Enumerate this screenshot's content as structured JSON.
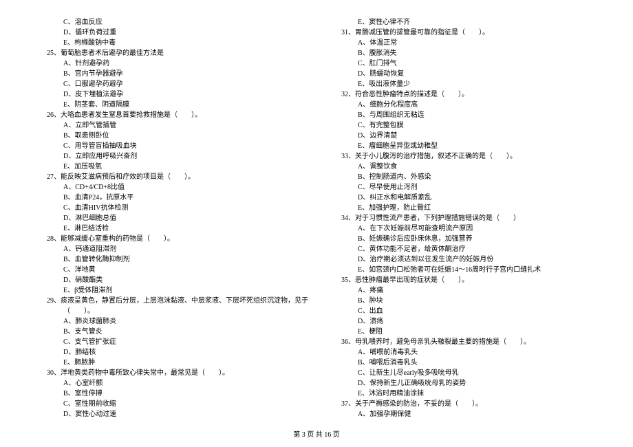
{
  "footer": "第 3 页 共 16 页",
  "left_column": [
    {
      "type": "option",
      "text": "C、溶血反应"
    },
    {
      "type": "option",
      "text": "D、循环负荷过重"
    },
    {
      "type": "option",
      "text": "E、枸橼酸钠中毒"
    },
    {
      "type": "question",
      "text": "25、葡萄胎患者术后避孕的最佳方法是"
    },
    {
      "type": "option",
      "text": "A、针剂避孕药"
    },
    {
      "type": "option",
      "text": "B、宫内节孕器避孕"
    },
    {
      "type": "option",
      "text": "C、口服避孕药避孕"
    },
    {
      "type": "option",
      "text": "D、皮下埋植法避孕"
    },
    {
      "type": "option",
      "text": "E、阴茎套、阴道隔膜"
    },
    {
      "type": "question",
      "text": "26、大咯血患者发生窒息首要抢救措施是（　　）。"
    },
    {
      "type": "option",
      "text": "A、立即气管插管"
    },
    {
      "type": "option",
      "text": "B、取患侧卧位"
    },
    {
      "type": "option",
      "text": "C、用导管盲插抽吸血块"
    },
    {
      "type": "option",
      "text": "D、立即应用呼吸兴奋剂"
    },
    {
      "type": "option",
      "text": "E、加压吸氧"
    },
    {
      "type": "question",
      "text": "27、能反映艾滋病预后和疗效的项目是（　　）。"
    },
    {
      "type": "option",
      "text": "A、CD+4/CD+8比值"
    },
    {
      "type": "option",
      "text": "B、血清P24，抗原水平"
    },
    {
      "type": "option",
      "text": "C、血清HIV抗体检测"
    },
    {
      "type": "option",
      "text": "D、淋巴细胞总值"
    },
    {
      "type": "option",
      "text": "E、淋巴结活检"
    },
    {
      "type": "question",
      "text": "28、能够减缓心室重构的药物是（　　）。"
    },
    {
      "type": "option",
      "text": "A、钙通道阻滞剂"
    },
    {
      "type": "option",
      "text": "B、血管转化酶抑制剂"
    },
    {
      "type": "option",
      "text": "C、洋地黄"
    },
    {
      "type": "option",
      "text": "D、硝酸酯类"
    },
    {
      "type": "option",
      "text": "E、β受体阻滞剂"
    },
    {
      "type": "question",
      "text": "29、痰液呈黄色，静置后分层，上层泡沫黏液、中层浆液、下层坏死组织沉淀物，见于"
    },
    {
      "type": "question-cont",
      "text": "（　　）。"
    },
    {
      "type": "option",
      "text": "A、肺炎球菌肺炎"
    },
    {
      "type": "option",
      "text": "B、支气管炎"
    },
    {
      "type": "option",
      "text": "C、支气管扩张症"
    },
    {
      "type": "option",
      "text": "D、肺结核"
    },
    {
      "type": "option",
      "text": "E、肺脓肿"
    },
    {
      "type": "question",
      "text": "30、洋地黄类药物中毒所致心律失常中，最常见是（　　）。"
    },
    {
      "type": "option",
      "text": "A、心室纤颤"
    },
    {
      "type": "option",
      "text": "B、室性停搏"
    },
    {
      "type": "option",
      "text": "C、室性期前收缩"
    },
    {
      "type": "option",
      "text": "D、窦性心动过速"
    }
  ],
  "right_column": [
    {
      "type": "option",
      "text": "E、窦性心律不齐"
    },
    {
      "type": "question",
      "text": "31、胃肠减压管的拔管最可靠的指征是（　　）。"
    },
    {
      "type": "option",
      "text": "A、体温正常"
    },
    {
      "type": "option",
      "text": "B、腹胀消失"
    },
    {
      "type": "option",
      "text": "C、肛门排气"
    },
    {
      "type": "option",
      "text": "D、肠蠕动恢复"
    },
    {
      "type": "option",
      "text": "E、吸出液体量少"
    },
    {
      "type": "question",
      "text": "32、符合恶性肿瘤特点的描述是（　　）。"
    },
    {
      "type": "option",
      "text": "A、细胞分化程度高"
    },
    {
      "type": "option",
      "text": "B、与周围组织无粘连"
    },
    {
      "type": "option",
      "text": "C、有完整包膜"
    },
    {
      "type": "option",
      "text": "D、边界清楚"
    },
    {
      "type": "option",
      "text": "E、瘤细胞呈异型或幼稚型"
    },
    {
      "type": "question",
      "text": "33、关于小儿腹泻的治疗措施，叙述不正确的是（　　）。"
    },
    {
      "type": "option",
      "text": "A、调整饮食"
    },
    {
      "type": "option",
      "text": "B、控制肠道内、外感染"
    },
    {
      "type": "option",
      "text": "C、尽早使用止泻剂"
    },
    {
      "type": "option",
      "text": "D、纠正水和电解质紊乱"
    },
    {
      "type": "option",
      "text": "E、加强护理，防止臀红"
    },
    {
      "type": "question",
      "text": "34、对于习惯性流产患者，下列护理措施错误的是（　　）"
    },
    {
      "type": "option",
      "text": "A、在下次妊娠前尽可能查明流产原因"
    },
    {
      "type": "option",
      "text": "B、妊娠确诊后应卧床休息，加强营养"
    },
    {
      "type": "option",
      "text": "C、黄体功能不足者，给黄体酮治疗"
    },
    {
      "type": "option",
      "text": "D、治疗期必须达到以往发生流产的妊娠月份"
    },
    {
      "type": "option",
      "text": "E、如宫颈内口松弛者可在妊娠14～16周时行子宫内口缝扎术"
    },
    {
      "type": "question",
      "text": "35、恶性肿瘤最早出现的症状是（　　）。"
    },
    {
      "type": "option",
      "text": "A、疼痛"
    },
    {
      "type": "option",
      "text": "B、肿块"
    },
    {
      "type": "option",
      "text": "C、出血"
    },
    {
      "type": "option",
      "text": "D、溃疡"
    },
    {
      "type": "option",
      "text": "E、梗阻"
    },
    {
      "type": "question",
      "text": "36、母乳喂养时，避免母亲乳头皲裂最主要的措施是（　　）。"
    },
    {
      "type": "option",
      "text": "A、哺喂前消毒乳头"
    },
    {
      "type": "option",
      "text": "B、哺喂后消毒乳头"
    },
    {
      "type": "option",
      "text": "C、让新生儿尽early吸多吸吮母乳"
    },
    {
      "type": "option",
      "text": "D、保持新生儿正确吸吮母乳的姿势"
    },
    {
      "type": "option",
      "text": "E、沐浴时用精油涂抹"
    },
    {
      "type": "question",
      "text": "37、关于产褥感染的防治，不妥的是（　　）。"
    },
    {
      "type": "option",
      "text": "A、加强孕期保健"
    }
  ]
}
